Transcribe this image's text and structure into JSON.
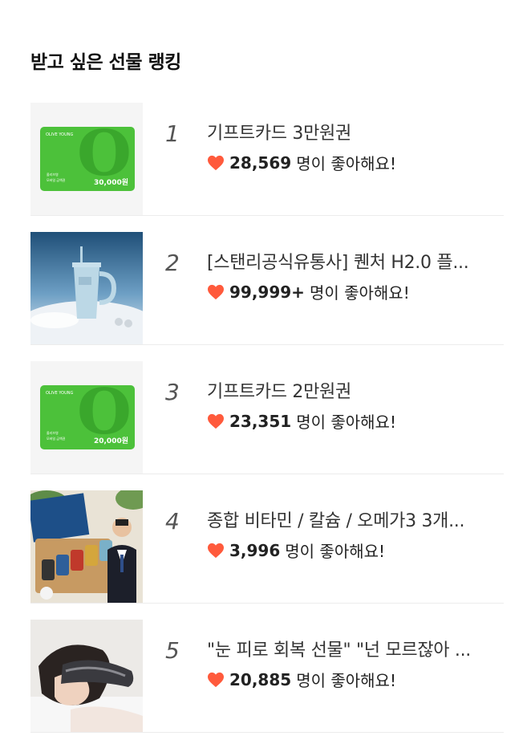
{
  "section": {
    "title": "받고 싶은 선물 랭킹"
  },
  "like_suffix": "명이 좋아해요!",
  "colors": {
    "heart": "#ff5a3c",
    "card_green": "#4cc13a"
  },
  "items": [
    {
      "rank": "1",
      "name": "기프트카드 3만원권",
      "likes": "28,569",
      "thumb": {
        "type": "gift-card",
        "brand": "OLIVE YOUNG",
        "amount": "30,000원",
        "sub1": "올리브영",
        "sub2": "모바일 금액권"
      }
    },
    {
      "rank": "2",
      "name": "[스탠리공식유통사] 퀜처 H2.0 플...",
      "likes": "99,999+",
      "thumb": {
        "type": "tumbler"
      }
    },
    {
      "rank": "3",
      "name": "기프트카드 2만원권",
      "likes": "23,351",
      "thumb": {
        "type": "gift-card",
        "brand": "OLIVE YOUNG",
        "amount": "20,000원",
        "sub1": "올리브영",
        "sub2": "모바일 금액권"
      }
    },
    {
      "rank": "4",
      "name": "종합 비타민 / 칼슘 / 오메가3 3개...",
      "likes": "3,996",
      "thumb": {
        "type": "vitamins"
      }
    },
    {
      "rank": "5",
      "name": "\"눈 피로 회복 선물\" \"넌 모르잖아 ...",
      "likes": "20,885",
      "thumb": {
        "type": "eye-massager"
      }
    }
  ]
}
